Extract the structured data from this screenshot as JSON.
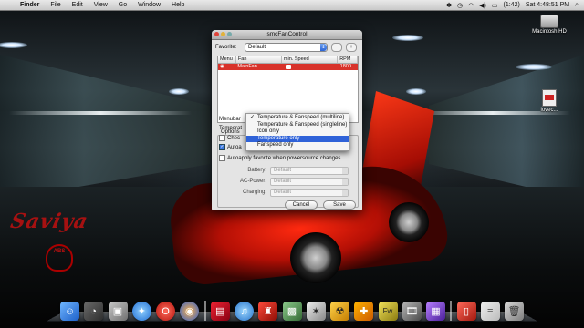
{
  "menubar": {
    "apple": "",
    "app_name": "Finder",
    "menus": [
      "File",
      "Edit",
      "View",
      "Go",
      "Window",
      "Help"
    ],
    "battery": "(1:42)",
    "clock": "Sat 4:48:51 PM"
  },
  "desktop": {
    "hd_label": "Macintosh HD",
    "file_label": "lovec..."
  },
  "wallpaper": {
    "logo_text": "Saviya",
    "badge_text": "ABS"
  },
  "window": {
    "title": "smcFanControl",
    "favorite_label": "Favorite:",
    "favorite_value": "Default",
    "add_button": "+",
    "table_headers": [
      "Menu",
      "Fan",
      "min. Speed",
      "RPM"
    ],
    "table_row": {
      "fan": "MainFan",
      "rpm": "1800"
    },
    "options_label": "Options",
    "menubar_label": "Menubar",
    "temperature_label": "Temperat",
    "check_label": "Chec",
    "autoapply_label": "Autoa",
    "autoapply_power_label": "Autoapply favorite when powersource changes",
    "battery_label": "Battery:",
    "battery_value": "Default",
    "ac_power_label": "AC-Power:",
    "ac_power_value": "Default",
    "charging_label": "Charging:",
    "charging_value": "Default",
    "cancel_label": "Cancel",
    "save_label": "Save"
  },
  "popup": {
    "items": [
      "Temperature & Fanspeed (multiline)",
      "Temperature & Fanspeed (singleline)",
      "Icon only",
      "Temperature only",
      "Fanspeed only"
    ],
    "checked_index": 0,
    "selected_index": 3
  },
  "dock": {
    "icons": [
      "finder-icon",
      "dashboard-icon",
      "preview-icon",
      "safari-icon",
      "opera-icon",
      "firefox-icon",
      "photo-booth-icon",
      "itunes-icon",
      "chair-icon",
      "iphoto-icon",
      "movie-icon",
      "app-icon",
      "itunes-icon",
      "fireworks-icon",
      "itunes-film-icon",
      "keynote-icon",
      "folder-icon",
      "document-icon",
      "trash-icon"
    ]
  }
}
